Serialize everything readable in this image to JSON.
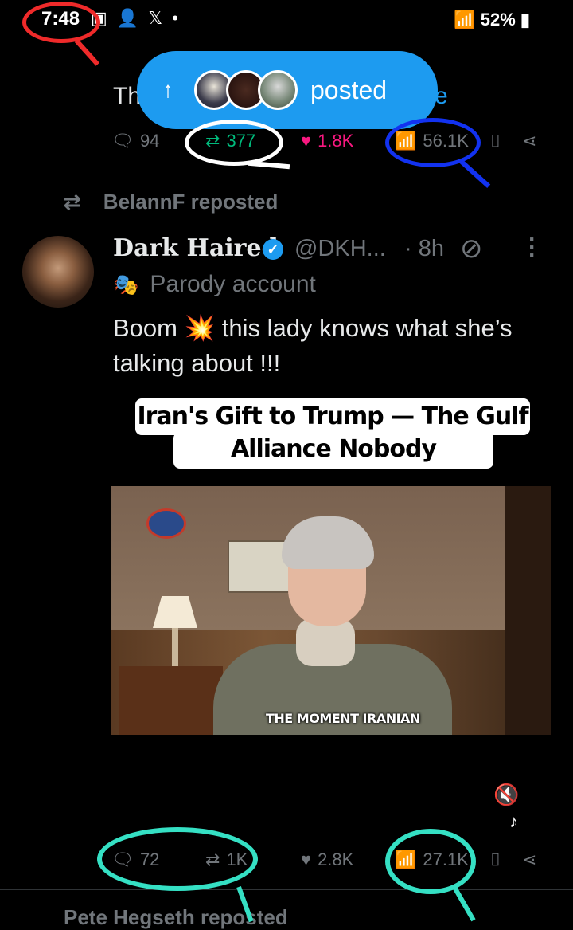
{
  "status_bar": {
    "time": "7:48",
    "left_icons": "▣ 👤 𝕏 •",
    "right_text": "52%"
  },
  "prev_tweet": {
    "text_fragment": "Th",
    "more_fragment": "re",
    "replies": "94",
    "reposts": "377",
    "likes": "1.8K",
    "views": "56.1K"
  },
  "posted_pill": {
    "label": "posted"
  },
  "tweet": {
    "repost_label": "BelannF reposted",
    "author_name": "Dark Haired",
    "handle": "@DKH...",
    "time": "· 8h",
    "parody_label": "Parody account",
    "text": "Boom 💥 this lady knows what she’s talking about !!!",
    "media": {
      "banner_line1": "Iran's Gift to Trump — The Gulf",
      "banner_line2": "Alliance Nobody Expected",
      "caption": "THE MOMENT IRANIAN"
    },
    "replies": "72",
    "reposts": "1K",
    "likes": "2.8K",
    "views": "27.1K"
  },
  "next_tweet": {
    "repost_label": "Pete Hegseth reposted"
  },
  "icons": {
    "reply": "reply-icon",
    "repost": "repost-icon",
    "like": "heart-icon",
    "views": "views-icon",
    "bookmark": "bookmark-icon",
    "share": "share-icon"
  },
  "colors": {
    "accent": "#1d9bf0",
    "repost_green": "#00ba7c",
    "like_pink": "#f91880",
    "muted": "#71767b"
  }
}
